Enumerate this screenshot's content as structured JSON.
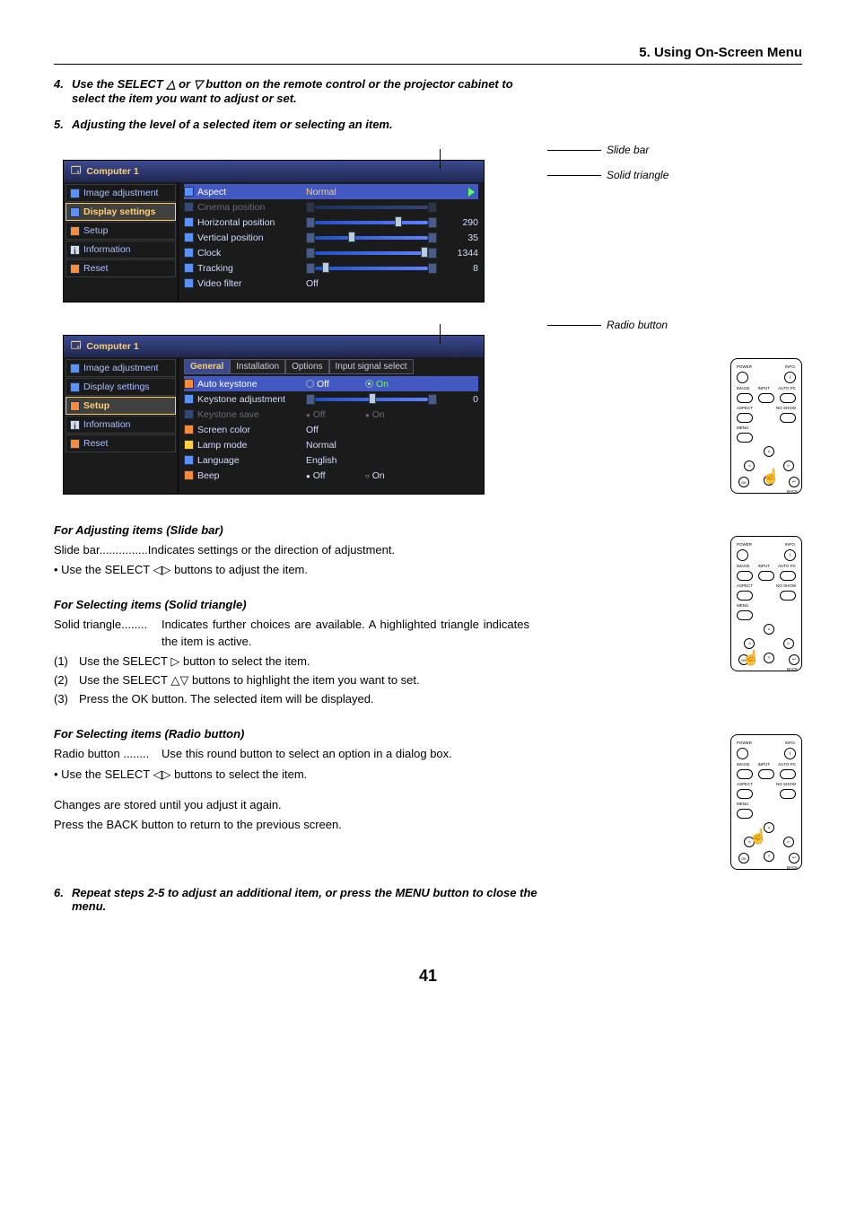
{
  "header": {
    "title": "5. Using On-Screen Menu"
  },
  "step4": {
    "num": "4.",
    "text": "Use the SELECT △ or ▽ button on the remote control or the projector cabinet to select the item you want to adjust or set."
  },
  "step5": {
    "num": "5.",
    "text": "Adjusting the level of a selected item or selecting an item."
  },
  "callouts": {
    "slide_bar": "Slide bar",
    "solid_triangle": "Solid triangle",
    "radio_button": "Radio button"
  },
  "osd1": {
    "title": "Computer 1",
    "side_items": [
      "Image adjustment",
      "Display settings",
      "Setup",
      "Information",
      "Reset"
    ],
    "active_side": 1,
    "rows": [
      {
        "icon": "aspect",
        "label": "Aspect",
        "value": "Normal",
        "triangle": true,
        "hi": true
      },
      {
        "icon": "cinema",
        "label": "Cinema position",
        "slider": true,
        "disabled": true
      },
      {
        "icon": "hpos",
        "label": "Horizontal position",
        "slider": true,
        "num": "290"
      },
      {
        "icon": "vpos",
        "label": "Vertical position",
        "slider": true,
        "num": "35"
      },
      {
        "icon": "clock",
        "label": "Clock",
        "slider": true,
        "num": "1344"
      },
      {
        "icon": "track",
        "label": "Tracking",
        "slider": true,
        "num": "8"
      },
      {
        "icon": "vfilt",
        "label": "Video filter",
        "value": "Off"
      }
    ]
  },
  "osd2": {
    "title": "Computer 1",
    "side_items": [
      "Image adjustment",
      "Display settings",
      "Setup",
      "Information",
      "Reset"
    ],
    "active_side": 2,
    "tabs": [
      "General",
      "Installation",
      "Options",
      "Input signal select"
    ],
    "active_tab": 0,
    "rows": [
      {
        "label": "Auto keystone",
        "radio_off": "Off",
        "radio_on": "On",
        "on": true,
        "hi": true
      },
      {
        "label": "Keystone adjustment",
        "slider": true,
        "num": "0"
      },
      {
        "label": "Keystone save",
        "radio_off": "Off",
        "radio_on": "On",
        "disabled": true
      },
      {
        "label": "Screen color",
        "value": "Off"
      },
      {
        "label": "Lamp mode",
        "value": "Normal"
      },
      {
        "label": "Language",
        "value": "English"
      },
      {
        "label": "Beep",
        "radio_off": "Off",
        "radio_on": "On",
        "dot_off": true
      }
    ]
  },
  "remote": {
    "labels": {
      "power": "POWER",
      "info": "INFO.",
      "image": "IMAGE",
      "input": "INPUT",
      "autopc": "AUTO PC",
      "aspect": "ASPECT",
      "noshow": "NO SHOW",
      "menu": "MENU",
      "ok": "OK",
      "back": "BACK"
    }
  },
  "sec_slide": {
    "title": "For Adjusting items (Slide bar)",
    "def_term": "Slide bar...............",
    "def_text": "Indicates settings or the direction of adjustment.",
    "bullet": "• Use the SELECT ◁▷ buttons to adjust the item."
  },
  "sec_triangle": {
    "title": "For Selecting items (Solid triangle)",
    "def_term": "Solid triangle........",
    "def_text": "Indicates further choices are available. A highlighted triangle indicates the item is active.",
    "steps": [
      "Use the SELECT ▷ button to select the item.",
      "Use the SELECT △▽ buttons to highlight the item you want to set.",
      "Press the OK button. The selected item will be displayed."
    ]
  },
  "sec_radio": {
    "title": "For Selecting items (Radio button)",
    "def_term": "Radio button ........",
    "def_text": "Use this round button to select an option in a dialog box.",
    "bullet": "• Use the SELECT ◁▷ buttons to select the item.",
    "after1": "Changes are stored until you adjust it again.",
    "after2": "Press the BACK button to return to the previous screen."
  },
  "step6": {
    "num": "6.",
    "text": "Repeat steps 2-5 to adjust an additional item, or press the MENU button to close the menu."
  },
  "page_number": "41"
}
